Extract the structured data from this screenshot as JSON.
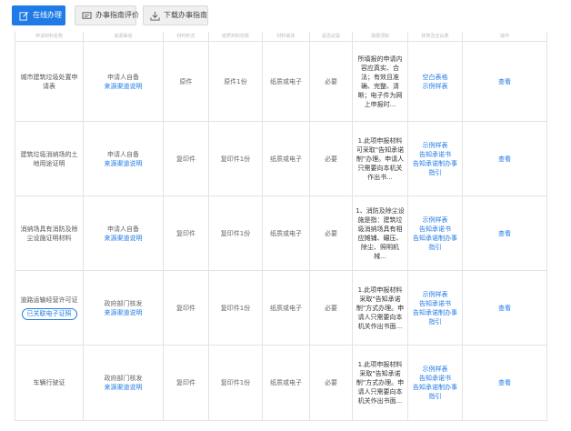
{
  "toolbar": {
    "online_label": "在线办理",
    "online_icon": "edit-icon",
    "eval_label": "办事指南评价",
    "eval_icon": "message-icon",
    "download_label": "下载办事指南",
    "download_icon": "download-icon"
  },
  "table": {
    "header_cells": [
      "申请材料名称",
      "来源渠道",
      "材料形式",
      "纸质材料份数",
      "材料载体",
      "是否必需",
      "填报须知",
      "样表及空白表",
      "操作"
    ],
    "rows": [
      {
        "name": "城市建筑垃圾处置申请表",
        "source_type": "申请人自备",
        "source_link": "来源渠道说明",
        "form": "原件",
        "copies": "原件1份",
        "medium": "纸质或电子",
        "required": "必要",
        "notice": "所填报的申请内容应真实、合法；有效且准确、完整、清晰；电子件为网上申报时...",
        "samples": [
          "空白表格",
          "示例样表"
        ],
        "action": "查看"
      },
      {
        "name": "建筑垃圾消纳场的土地用途证明",
        "source_type": "申请人自备",
        "source_link": "来源渠道说明",
        "form": "复印件",
        "copies": "复印件1份",
        "medium": "纸质或电子",
        "required": "必要",
        "notice": "1.此项申报材料可采取\"告知承诺制\"办理。申请人只需要向本机关作出书...",
        "samples": [
          "示例样表",
          "告知承诺书",
          "告知承诺制办事指引"
        ],
        "action": "查看"
      },
      {
        "name": "消纳场具有消防及除尘设施证明材料",
        "source_type": "申请人自备",
        "source_link": "来源渠道说明",
        "form": "复印件",
        "copies": "复印件1份",
        "medium": "纸质或电子",
        "required": "必要",
        "notice": "1、消防及除尘设施是指：建筑垃圾消纳场具有相应摊铺、碾压、除尘、照明机械...",
        "samples": [
          "示例样表",
          "告知承诺书",
          "告知承诺制办事指引"
        ],
        "action": "查看"
      },
      {
        "name": "道路运输经营许可证",
        "name_tag": "已关联电子证照",
        "source_type": "政府部门核发",
        "source_link": "来源渠道说明",
        "form": "复印件",
        "copies": "复印件1份",
        "medium": "纸质或电子",
        "required": "必要",
        "notice": "1.此项申报材料采取\"告知承诺制\"方式办理。申请人只需要向本机关作出书面...",
        "samples": [
          "示例样表",
          "告知承诺书",
          "告知承诺制办事指引"
        ],
        "action": "查看"
      },
      {
        "name": "车辆行驶证",
        "source_type": "政府部门核发",
        "source_link": "来源渠道说明",
        "form": "复印件",
        "copies": "复印件1份",
        "medium": "纸质或电子",
        "required": "必要",
        "notice": "1.此项申报材料采取\"告知承诺制\"方式办理。申请人只需要向本机关作出书面...",
        "samples": [
          "示例样表",
          "告知承诺书",
          "告知承诺制办事指引"
        ],
        "action": "查看"
      }
    ]
  },
  "colors": {
    "primary": "#1f7be6",
    "border": "#e3e3e3"
  }
}
